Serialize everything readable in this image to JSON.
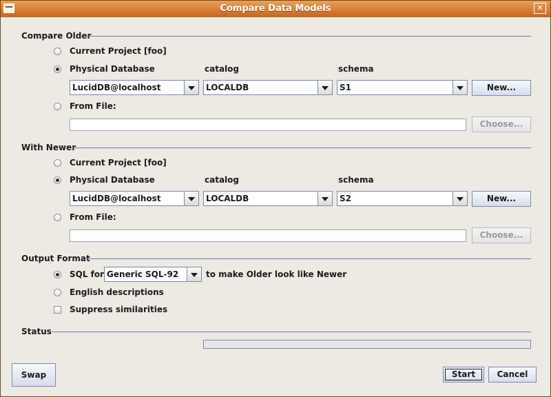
{
  "window": {
    "title": "Compare Data Models",
    "close_glyph": "✕"
  },
  "older": {
    "section_label": "Compare Older",
    "current_project": "Current Project [foo]",
    "physical_database": "Physical Database",
    "catalog_label": "catalog",
    "schema_label": "schema",
    "database_value": "LucidDB@localhost",
    "catalog_value": "LOCALDB",
    "schema_value": "S1",
    "new_button": "New...",
    "from_file": "From File:",
    "file_value": "",
    "choose_button": "Choose...",
    "selected": "physical_database"
  },
  "newer": {
    "section_label": "With Newer",
    "current_project": "Current Project [foo]",
    "physical_database": "Physical Database",
    "catalog_label": "catalog",
    "schema_label": "schema",
    "database_value": "LucidDB@localhost",
    "catalog_value": "LOCALDB",
    "schema_value": "S2",
    "new_button": "New...",
    "from_file": "From File:",
    "file_value": "",
    "choose_button": "Choose...",
    "selected": "physical_database"
  },
  "output": {
    "section_label": "Output Format",
    "sql_for": "SQL for",
    "sql_dialect": "Generic SQL-92",
    "sql_suffix": "to make Older look like Newer",
    "english": "English descriptions",
    "suppress": "Suppress similarities",
    "selected": "sql",
    "suppress_checked": false
  },
  "status": {
    "section_label": "Status",
    "progress": 0
  },
  "buttons": {
    "swap": "Swap",
    "start": "Start",
    "cancel": "Cancel"
  },
  "colors": {
    "titlebar_top": "#e8a15a",
    "titlebar_bottom": "#c8641e",
    "separator": "#6f7fa8",
    "background": "#ede9e3"
  }
}
